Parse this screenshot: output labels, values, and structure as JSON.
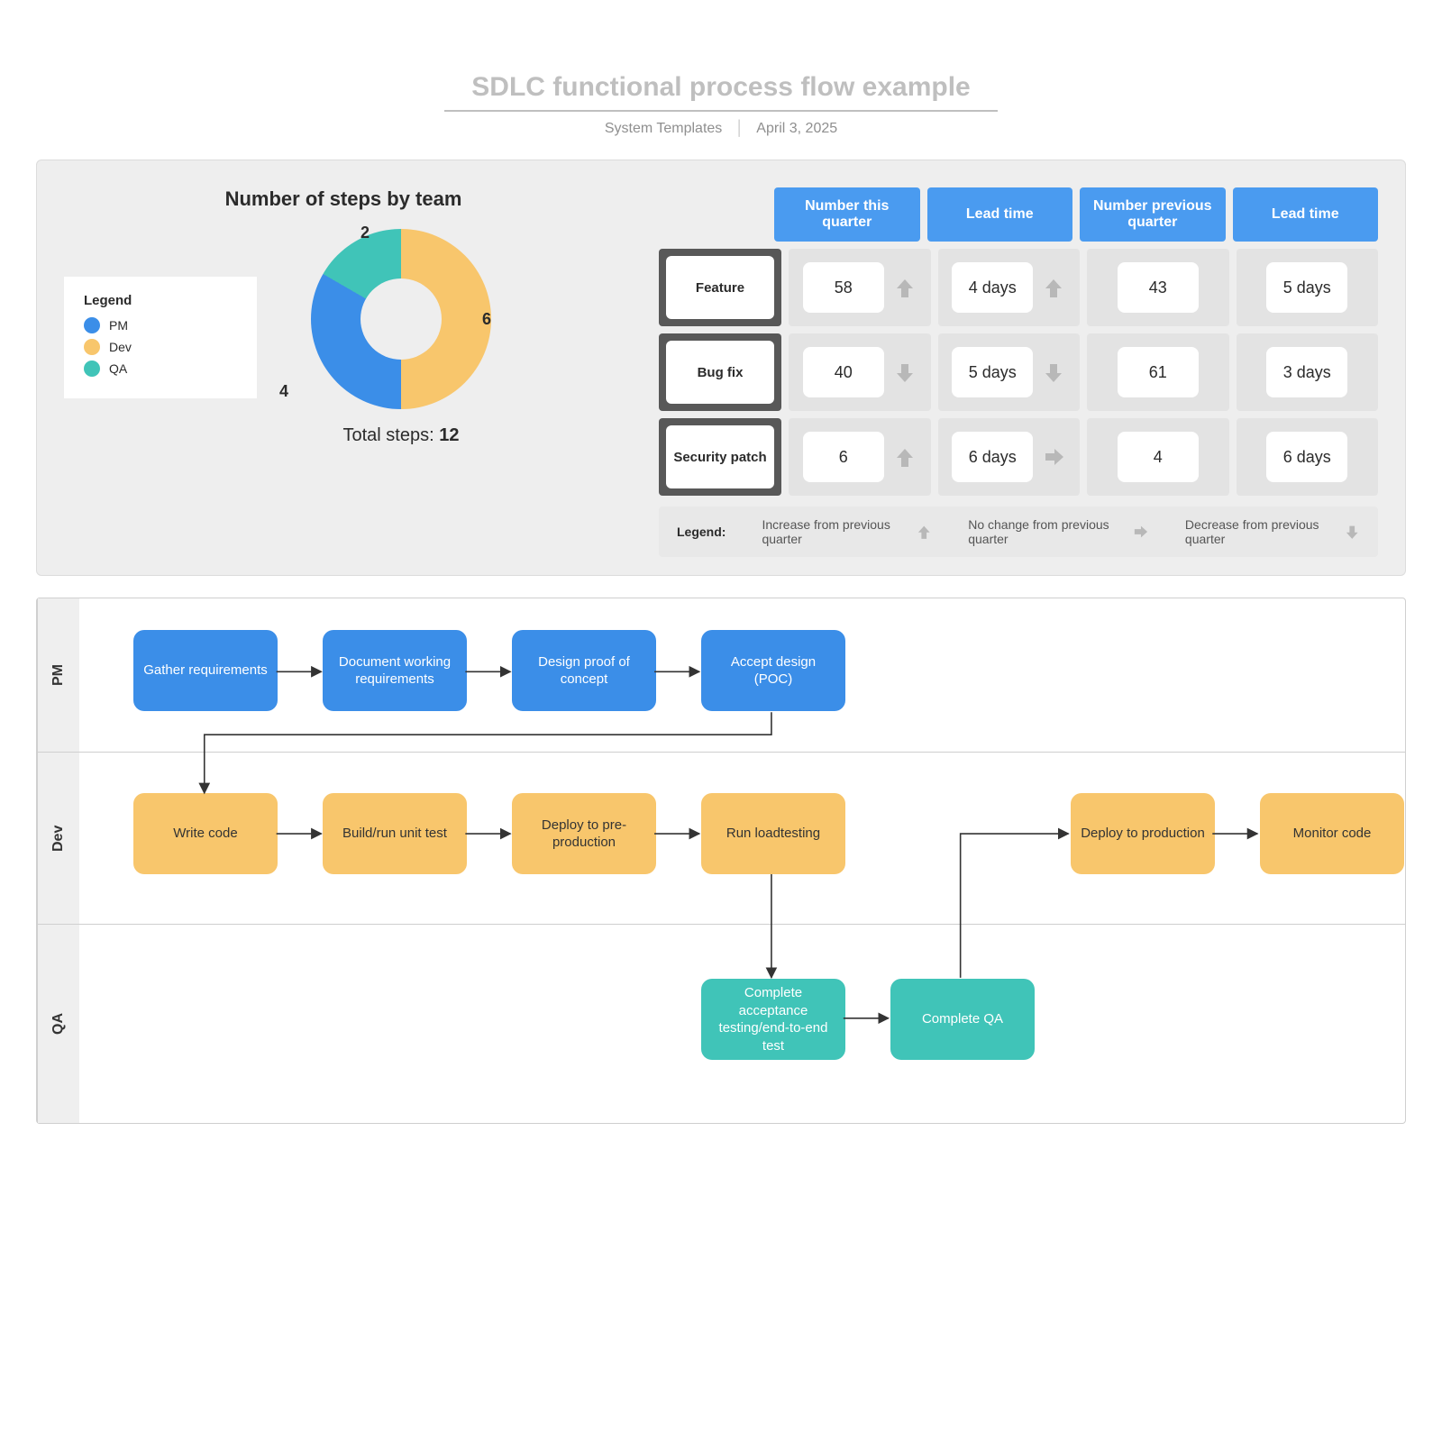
{
  "title": "SDLC functional process flow example",
  "subtitle_author": "System Templates",
  "subtitle_date": "April 3, 2025",
  "donut": {
    "title": "Number of steps by team",
    "legend_title": "Legend",
    "items": [
      {
        "label": "PM",
        "color": "#3b8ee8",
        "value": 4
      },
      {
        "label": "Dev",
        "color": "#f8c66c",
        "value": 6
      },
      {
        "label": "QA",
        "color": "#40c4b8",
        "value": 2
      }
    ],
    "total_label": "Total steps:",
    "total_value": "12"
  },
  "metrics": {
    "headers": [
      "Number this quarter",
      "Lead time",
      "Number previous quarter",
      "Lead time"
    ],
    "rows": [
      {
        "label": "Feature",
        "cells": [
          {
            "v": "58",
            "dir": "up"
          },
          {
            "v": "4 days",
            "dir": "up"
          },
          {
            "v": "43",
            "dir": ""
          },
          {
            "v": "5 days",
            "dir": ""
          }
        ]
      },
      {
        "label": "Bug fix",
        "cells": [
          {
            "v": "40",
            "dir": "down"
          },
          {
            "v": "5 days",
            "dir": "down"
          },
          {
            "v": "61",
            "dir": ""
          },
          {
            "v": "3 days",
            "dir": ""
          }
        ]
      },
      {
        "label": "Security patch",
        "cells": [
          {
            "v": "6",
            "dir": "up"
          },
          {
            "v": "6 days",
            "dir": "right"
          },
          {
            "v": "4",
            "dir": ""
          },
          {
            "v": "6 days",
            "dir": ""
          }
        ]
      }
    ],
    "legend_title": "Legend:",
    "legend_items": [
      {
        "text": "Increase from previous quarter",
        "dir": "up"
      },
      {
        "text": "No change from previous quarter",
        "dir": "right"
      },
      {
        "text": "Decrease from previous quarter",
        "dir": "down"
      }
    ]
  },
  "swimlanes": [
    {
      "name": "PM",
      "color": "blue",
      "nodes": [
        {
          "id": "n1",
          "text": "Gather requirements"
        },
        {
          "id": "n2",
          "text": "Document working requirements"
        },
        {
          "id": "n3",
          "text": "Design proof of concept"
        },
        {
          "id": "n4",
          "text": "Accept design (POC)"
        }
      ]
    },
    {
      "name": "Dev",
      "color": "yellow",
      "nodes": [
        {
          "id": "n5",
          "text": "Write code"
        },
        {
          "id": "n6",
          "text": "Build/run unit test"
        },
        {
          "id": "n7",
          "text": "Deploy to pre-production"
        },
        {
          "id": "n8",
          "text": "Run loadtesting"
        },
        {
          "id": "n9",
          "text": "Deploy to production"
        },
        {
          "id": "n10",
          "text": "Monitor code"
        }
      ]
    },
    {
      "name": "QA",
      "color": "teal",
      "nodes": [
        {
          "id": "n11",
          "text": "Complete acceptance testing/end-to-end test"
        },
        {
          "id": "n12",
          "text": "Complete QA"
        }
      ]
    }
  ],
  "chart_data": {
    "type": "pie",
    "title": "Number of steps by team",
    "categories": [
      "PM",
      "Dev",
      "QA"
    ],
    "values": [
      4,
      6,
      2
    ],
    "total": 12,
    "colors": [
      "#3b8ee8",
      "#f8c66c",
      "#40c4b8"
    ]
  }
}
